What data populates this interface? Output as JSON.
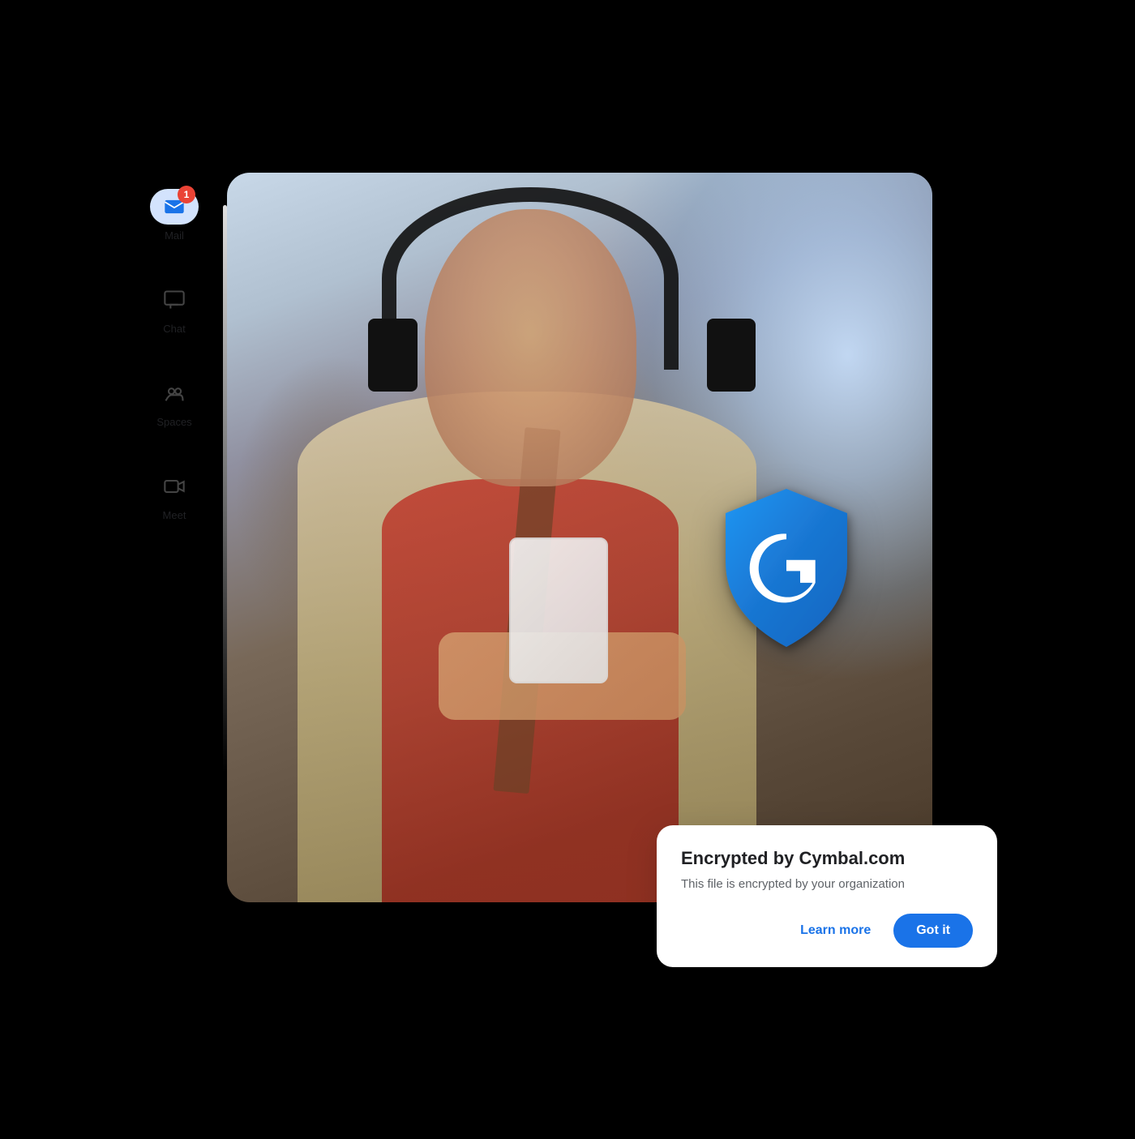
{
  "sidebar": {
    "items": [
      {
        "id": "mail",
        "label": "Mail",
        "badge": "1",
        "active": true
      },
      {
        "id": "chat",
        "label": "Chat",
        "badge": null,
        "active": false
      },
      {
        "id": "spaces",
        "label": "Spaces",
        "badge": null,
        "active": false
      },
      {
        "id": "meet",
        "label": "Meet",
        "badge": null,
        "active": false
      }
    ]
  },
  "encryption_dialog": {
    "title": "Encrypted by Cymbal.com",
    "subtitle": "This file is encrypted by your organization",
    "learn_more_label": "Learn more",
    "got_it_label": "Got it"
  },
  "colors": {
    "primary_blue": "#1a73e8",
    "badge_red": "#ea4335",
    "shield_blue": "#1a73e8",
    "shield_dark": "#1557b0"
  }
}
